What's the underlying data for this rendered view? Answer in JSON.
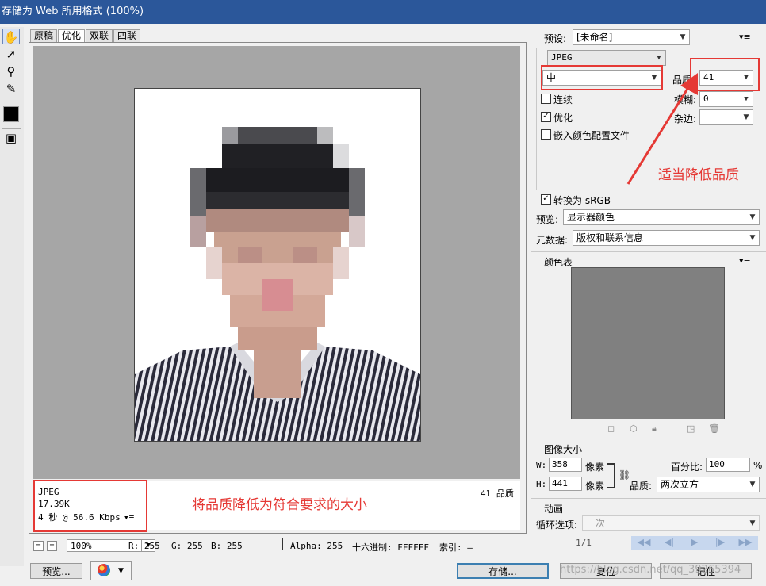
{
  "window": {
    "title": "存储为 Web 所用格式 (100%)"
  },
  "tabs": [
    "原稿",
    "优化",
    "双联",
    "四联"
  ],
  "image_info": {
    "format": "JPEG",
    "size": "17.39K",
    "time": "4 秒 @ 56.6 Kbps",
    "quality_text": "41 品质"
  },
  "annotations": {
    "info_note": "将品质降低为符合要求的大小",
    "quality_note": "适当降低品质"
  },
  "statusbar": {
    "zoom": "100%",
    "r": "R: 255",
    "g": "G: 255",
    "b": "B: 255",
    "alpha": "Alpha: 255",
    "hex": "十六进制: FFFFFF",
    "index": "索引: —"
  },
  "buttons": {
    "preview": "预览...",
    "save": "存储...",
    "reset": "复位",
    "remember": "记住"
  },
  "settings": {
    "preset_label": "预设:",
    "preset_value": "[未命名]",
    "format_value": "JPEG",
    "compression_value": "中",
    "quality_label": "品质:",
    "quality_value": "41",
    "progressive_label": "连续",
    "blur_label": "模糊:",
    "blur_value": "0",
    "optimized_label": "优化",
    "matte_label": "杂边:",
    "embed_profile_label": "嵌入颜色配置文件",
    "convert_srgb_label": "转换为 sRGB",
    "preview_label": "预览:",
    "preview_value": "显示器颜色",
    "metadata_label": "元数据:",
    "metadata_value": "版权和联系信息"
  },
  "color_table": {
    "title": "颜色表"
  },
  "image_size": {
    "title": "图像大小",
    "w_label": "W:",
    "w_value": "358",
    "h_label": "H:",
    "h_value": "441",
    "unit": "像素",
    "percent_label": "百分比:",
    "percent_value": "100",
    "percent_sign": "%",
    "quality_label": "品质:",
    "quality_value": "两次立方"
  },
  "animation": {
    "title": "动画",
    "loop_label": "循环选项:",
    "loop_value": "一次",
    "frame": "1/1"
  },
  "watermark": "https://blog.csdn.net/qq_39265394",
  "colors": {
    "annotation": "#e53935",
    "titlebar": "#2b579a"
  }
}
